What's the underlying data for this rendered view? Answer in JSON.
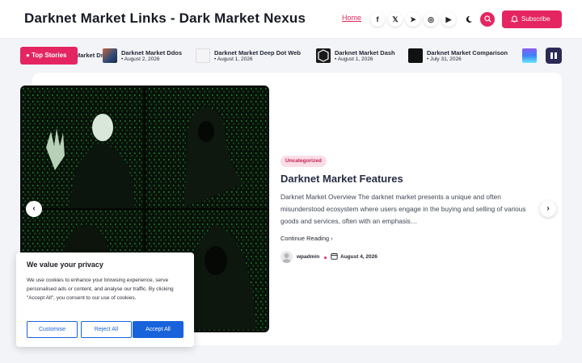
{
  "header": {
    "site_title": "Darknet Market Links - Dark Market Nexus",
    "nav_home": "Home",
    "social": [
      {
        "name": "facebook-icon",
        "glyph": "f"
      },
      {
        "name": "x-twitter-icon",
        "glyph": "𝕏"
      },
      {
        "name": "telegram-icon",
        "glyph": "➤"
      },
      {
        "name": "instagram-icon",
        "glyph": "◎"
      },
      {
        "name": "youtube-icon",
        "glyph": "▶"
      }
    ],
    "subscribe_label": "Subscribe"
  },
  "ticker": {
    "label": "Top Stories",
    "items": [
      {
        "title": "Darknet Market Dmt",
        "date": ""
      },
      {
        "title": "Darknet Market Ddos",
        "date": "August 2, 2026"
      },
      {
        "title": "Darknet Market Deep Dot Web",
        "date": "August 1, 2026"
      },
      {
        "title": "Darknet Market Dash",
        "date": "August 1, 2026"
      },
      {
        "title": "Darknet Market Comparison",
        "date": "July 31, 2026"
      }
    ]
  },
  "post": {
    "category": "Uncategorized",
    "title": "Darknet Market Features",
    "excerpt": "Darknet Market Overview The darknet market presents a unique and often misunderstood ecosystem where users engage in the buying and selling of various goods and services, often with an emphasis…",
    "read_more": "Continue Reading",
    "author": "wpadmin",
    "date": "August 4, 2026"
  },
  "cookie": {
    "title": "We value your privacy",
    "body": "We use cookies to enhance your browsing experience, serve personalised ads or content, and analyse our traffic. By clicking \"Accept All\", you consent to our use of cookies.",
    "customise": "Customise",
    "reject": "Reject All",
    "accept": "Accept All"
  },
  "colors": {
    "accent": "#e52561",
    "cookie_blue": "#1863dc",
    "title_navy": "#272c46"
  }
}
